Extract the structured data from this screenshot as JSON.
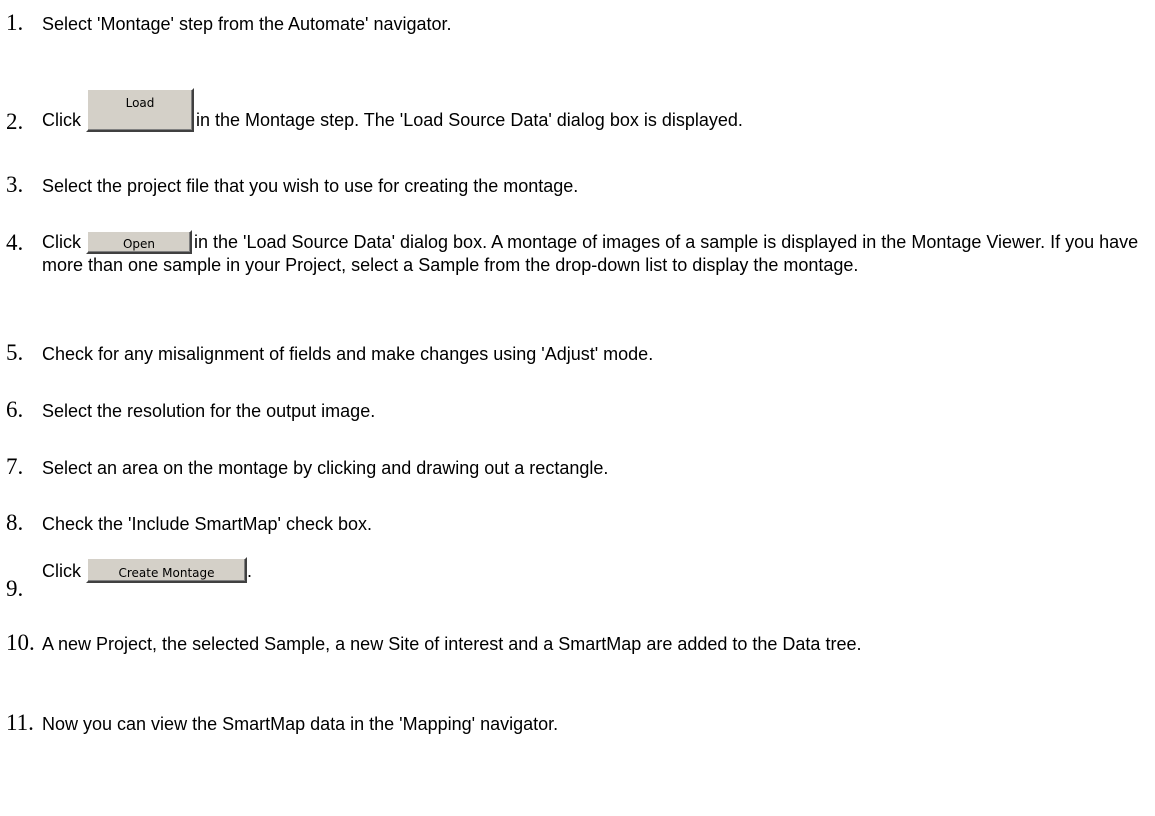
{
  "steps": [
    {
      "number": "1.",
      "text": "Select 'Montage' step from the Automate' navigator."
    },
    {
      "number": "2.",
      "before": "Click ",
      "button": "Load",
      "after": "in the Montage step. The 'Load Source Data' dialog box is displayed."
    },
    {
      "number": "3.",
      "text": "Select the project file that you wish to use for creating the montage."
    },
    {
      "number": "4.",
      "before": "Click ",
      "button": "Open",
      "after": "in the 'Load Source Data' dialog box. A montage of images of a sample is displayed in the Montage Viewer. If you have more than one sample in your Project, select a Sample from the drop-down list to display the montage."
    },
    {
      "number": "5.",
      "text": "Check for any misalignment of fields and make changes using 'Adjust' mode."
    },
    {
      "number": "6.",
      "text": "Select the resolution for the output image."
    },
    {
      "number": "7.",
      "text": "Select an area on the montage by clicking and drawing out a rectangle."
    },
    {
      "number": "8.",
      "text": "Check the 'Include SmartMap' check box."
    },
    {
      "number": "9.",
      "before": "Click ",
      "button": "Create Montage",
      "after": "."
    },
    {
      "number": "10.",
      "text": "A new Project, the selected Sample, a new Site of interest and a SmartMap are added to the Data tree."
    },
    {
      "number": "11.",
      "text": "Now you can view the SmartMap data in the 'Mapping' navigator."
    }
  ]
}
